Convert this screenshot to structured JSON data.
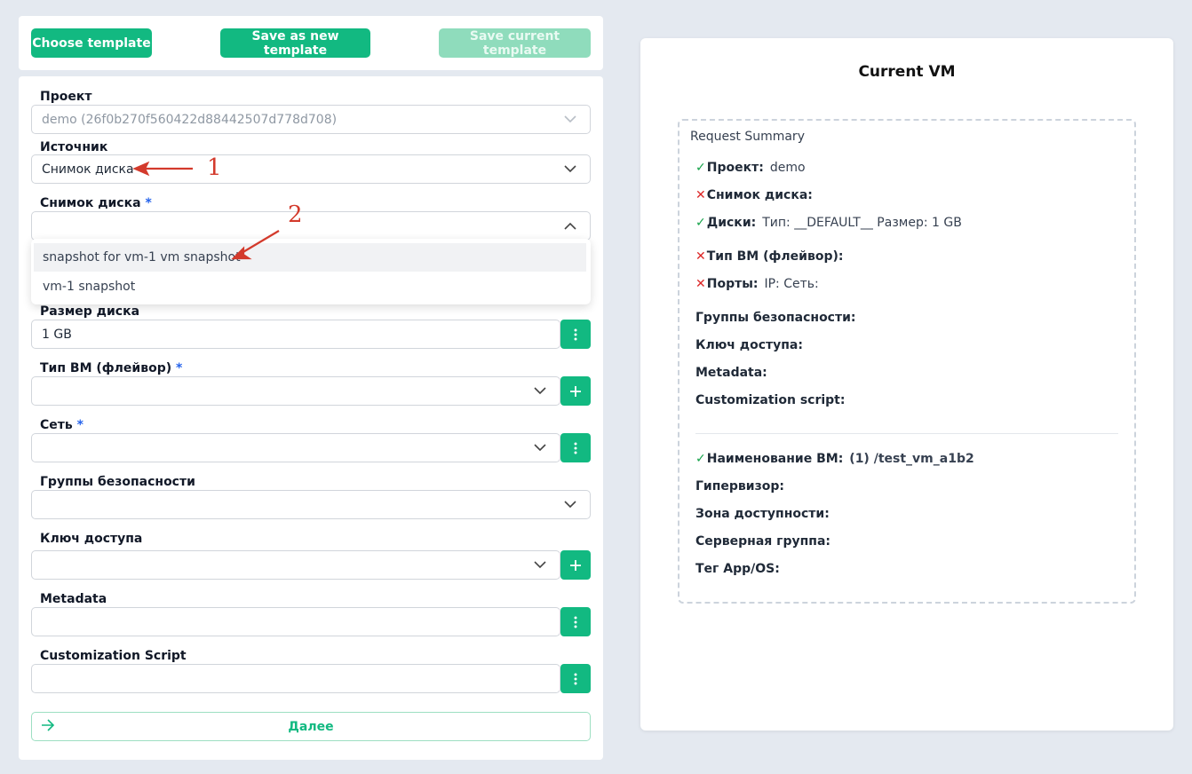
{
  "toolbar": {
    "choose_template": "Choose template",
    "save_as_new_template": "Save as new template",
    "save_current_template": "Save current template"
  },
  "form": {
    "project": {
      "label": "Проект",
      "value": "demo (26f0b270f560422d88442507d778d708)"
    },
    "source": {
      "label": "Источник",
      "value": "Снимок диска"
    },
    "snapshot": {
      "label": "Снимок диска",
      "required": "*",
      "value": ""
    },
    "snapshot_options": [
      "snapshot for vm-1 vm snapshot",
      "vm-1 snapshot"
    ],
    "disk_size": {
      "label": "Размер диска",
      "value": "1 GB"
    },
    "flavor": {
      "label": "Тип ВМ (флейвор)",
      "required": "*",
      "value": ""
    },
    "network": {
      "label": "Сеть",
      "required": "*",
      "value": ""
    },
    "security_groups": {
      "label": "Группы безопасности",
      "value": ""
    },
    "access_key": {
      "label": "Ключ доступа",
      "value": ""
    },
    "metadata": {
      "label": "Metadata",
      "value": ""
    },
    "customization_script": {
      "label": "Customization Script",
      "value": ""
    },
    "next_label": "Далее"
  },
  "panel": {
    "title": "Current VM",
    "summary_title": "Request Summary",
    "rows": [
      {
        "status": "ok",
        "key": "Проект:",
        "value": "demo"
      },
      {
        "status": "no",
        "key": "Снимок диска:",
        "value": ""
      },
      {
        "status": "ok",
        "key": "Диски:",
        "value": "Тип: __DEFAULT__  Размер: 1 GB"
      },
      {
        "status": "no",
        "key": "Тип ВМ (флейвор):",
        "value": ""
      },
      {
        "status": "no",
        "key": "Порты:",
        "value": "IP:  Сеть:"
      },
      {
        "status": "none",
        "key": "Группы безопасности:",
        "value": ""
      },
      {
        "status": "none",
        "key": "Ключ доступа:",
        "value": ""
      },
      {
        "status": "none",
        "key": "Metadata:",
        "value": ""
      },
      {
        "status": "none",
        "key": "Customization script:",
        "value": ""
      },
      {
        "status": "ok",
        "key": "Наименование ВМ:",
        "value": "(1) /test_vm_a1b2"
      },
      {
        "status": "none",
        "key": "Гипервизор:",
        "value": ""
      },
      {
        "status": "none",
        "key": "Зона доступности:",
        "value": ""
      },
      {
        "status": "none",
        "key": "Серверная группа:",
        "value": ""
      },
      {
        "status": "none",
        "key": "Тег App/OS:",
        "value": ""
      }
    ]
  },
  "annotations": [
    "1",
    "2"
  ],
  "colors": {
    "accent": "#12b981",
    "accent_disabled": "#8fdcbc",
    "required": "#2563eb",
    "ok": "#16a34a",
    "error": "#dc2626",
    "annotation": "#d33a2c"
  }
}
